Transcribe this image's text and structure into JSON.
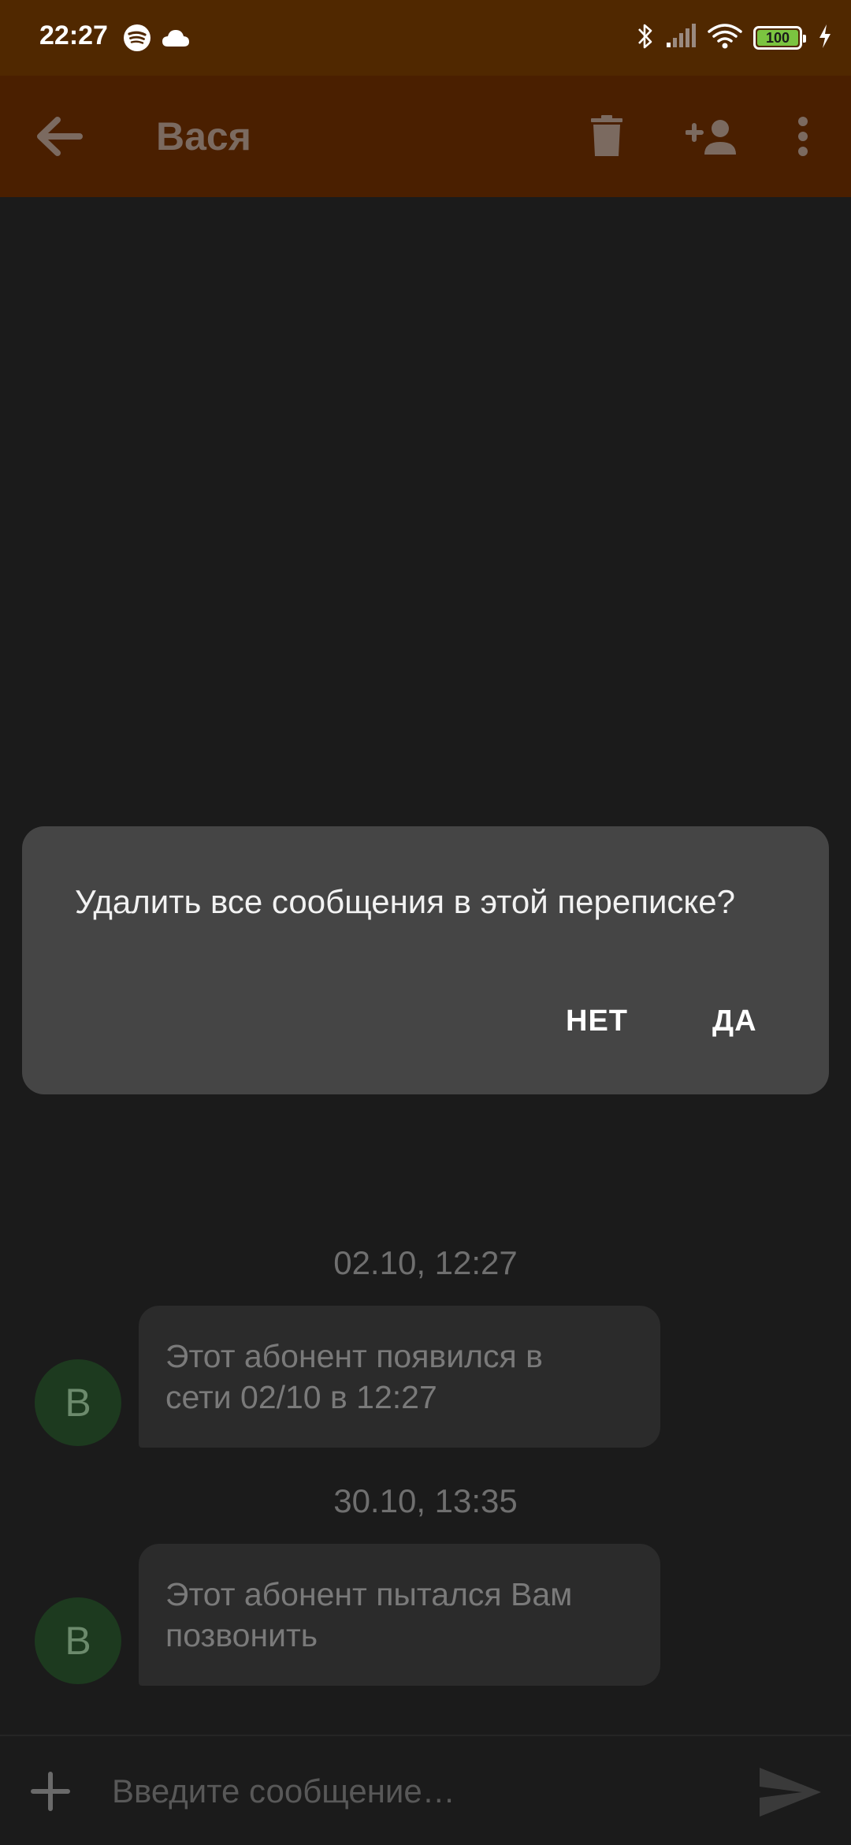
{
  "status_bar": {
    "time": "22:27",
    "battery_level": "100",
    "icons": [
      "spotify-icon",
      "cloud-icon",
      "bluetooth-icon",
      "signal-icon",
      "wifi-icon",
      "battery-icon",
      "charging-icon"
    ]
  },
  "toolbar": {
    "title": "Вася",
    "icons": [
      "back-arrow-icon",
      "trash-icon",
      "add-contact-icon",
      "more-vert-icon"
    ]
  },
  "messages": [
    {
      "date": "02.10, 12:27",
      "avatar_letter": "В",
      "text_line1": "Этот абонент появился в",
      "text_line2": "сети 02/10 в 12:27"
    },
    {
      "date": "30.10, 13:35",
      "avatar_letter": "В",
      "text_line1": "Этот абонент пытался Вам",
      "text_line2": "позвонить"
    }
  ],
  "dialog": {
    "message": "Удалить все сообщения в этой переписке?",
    "negative": "НЕТ",
    "positive": "ДА"
  },
  "composer": {
    "placeholder": "Введите сообщение…",
    "value": ""
  },
  "colors": {
    "status_bar": "#502800",
    "toolbar": "#4a1f00",
    "background": "#1b1b1b",
    "dialog": "#454545",
    "avatar": "#1d3a1f",
    "battery_fill": "#7bc440"
  }
}
